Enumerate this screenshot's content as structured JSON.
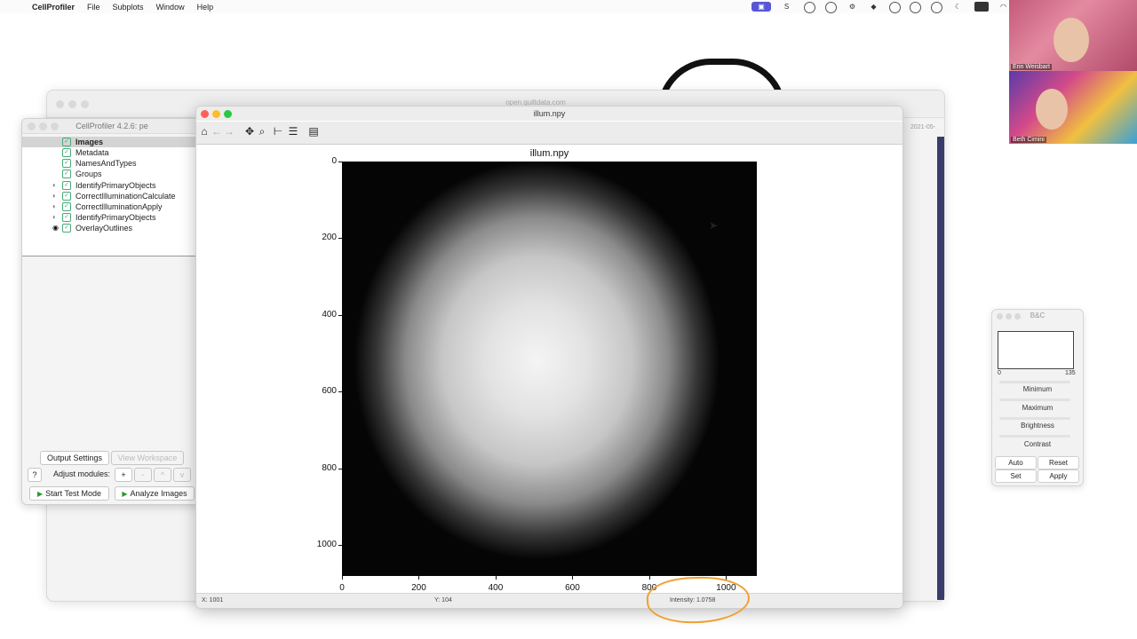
{
  "menubar": {
    "apple_icon": "apple-icon",
    "app": "CellProfiler",
    "items": [
      "File",
      "Subplots",
      "Window",
      "Help"
    ]
  },
  "browser": {
    "url": "open.quiltdata.com",
    "date_hint": "2021-05-"
  },
  "cellprofiler": {
    "title": "CellProfiler 4.2.6: pe",
    "modules": [
      {
        "label": "Images",
        "selected": true
      },
      {
        "label": "Metadata"
      },
      {
        "label": "NamesAndTypes"
      },
      {
        "label": "Groups"
      },
      {
        "label": "IdentifyPrimaryObjects"
      },
      {
        "label": "CorrectIlluminationCalculate"
      },
      {
        "label": "CorrectIlluminationApply"
      },
      {
        "label": "IdentifyPrimaryObjects"
      },
      {
        "label": "OverlayOutlines"
      }
    ],
    "output_settings": "Output Settings",
    "view_workspace": "View Workspace",
    "help": "?",
    "adjust_modules": "Adjust modules:",
    "add": "+",
    "remove": "-",
    "up": "^",
    "down": "v",
    "start_test_mode": "Start Test Mode",
    "analyze_images": "Analyze Images"
  },
  "figure": {
    "window_title": "illum.npy",
    "plot_title": "illum.npy",
    "status": {
      "x": "X: 1001",
      "y": "Y: 104",
      "intensity": "Intensity: 1.0758"
    },
    "toolbar_icons": [
      "home-icon",
      "back-icon",
      "forward-icon",
      "pan-icon",
      "zoom-icon",
      "subplots-icon",
      "customize-icon",
      "save-icon"
    ]
  },
  "chart_data": {
    "type": "heatmap",
    "title": "illum.npy",
    "xlabel": "",
    "ylabel": "",
    "xlim": [
      0,
      1080
    ],
    "ylim": [
      1080,
      0
    ],
    "x_ticks": [
      "0",
      "200",
      "400",
      "600",
      "800",
      "1000"
    ],
    "y_ticks": [
      "0",
      "200",
      "400",
      "600",
      "800",
      "1000"
    ],
    "colormap": "gray",
    "description_values": {
      "cursor_x": 1001,
      "cursor_y": 104,
      "cursor_intensity": 1.0758
    }
  },
  "bc_panel": {
    "title": "B&C",
    "hist_min": "0",
    "hist_max": "135",
    "minimum": "Minimum",
    "maximum": "Maximum",
    "brightness": "Brightness",
    "contrast": "Contrast",
    "auto": "Auto",
    "reset": "Reset",
    "set": "Set",
    "apply": "Apply"
  },
  "video": {
    "person1": "Erin Weisbart",
    "person2": "Beth Cimini"
  },
  "colors": {
    "annotation": "#f0a030",
    "check_green": "#44aa77",
    "traffic_red": "#ff5f57",
    "traffic_yellow": "#febc2e",
    "traffic_green": "#28c840"
  }
}
